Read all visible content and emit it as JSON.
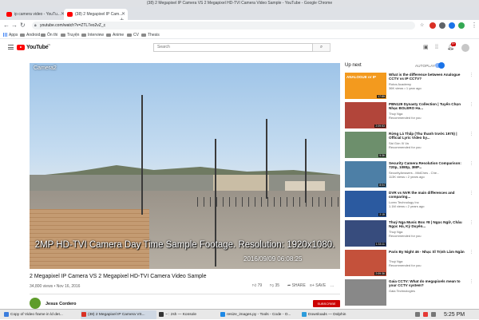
{
  "window": {
    "title": "(38) 2 Megapixel IP Camera VS 2 Megapixel HD-TVI Camera Video Sample - YouTube - Google Chrome"
  },
  "tabs": [
    {
      "label": "ip camera video - YouTu...",
      "active": false
    },
    {
      "label": "(38) 2 Megapixel IP Cam...",
      "active": true
    }
  ],
  "toolbar": {
    "back_icon": "arrow-left-icon",
    "forward_icon": "arrow-right-icon",
    "reload_icon": "reload-icon",
    "url": "youtube.com/watch?v=ZTL7eo2vZ_c",
    "star_icon": "star-icon",
    "menu_icon": "kebab-icon"
  },
  "bookmarks": [
    {
      "label": "Apps"
    },
    {
      "label": "Android"
    },
    {
      "label": "Ôn thi"
    },
    {
      "label": "Truyện"
    },
    {
      "label": "Interview"
    },
    {
      "label": "Anime"
    },
    {
      "label": "CV"
    },
    {
      "label": "Thesis"
    }
  ],
  "youtube": {
    "logo_text": "YouTube",
    "logo_country": "VN",
    "search_placeholder": "Search",
    "notification_count": "9+"
  },
  "video": {
    "camera_label": "Camera2",
    "caption": "2MP HD-TVI Camera Day Time Sample Footage. Resolution: 1920x1080.",
    "timestamp": "2016/09/09 06:08:25",
    "title": "2 Megapixel IP Camera VS 2 Megapixel HD-TVI Camera Video Sample",
    "views_date": "34,800 views • Nov 16, 2016",
    "likes": "79",
    "dislikes": "35",
    "share_label": "SHARE",
    "save_label": "SAVE",
    "more_label": "...",
    "channel": "Jesus Cordero",
    "subscribe_label": "SUBSCRIBE"
  },
  "sidebar": {
    "up_next_label": "Up next",
    "autoplay_label": "AUTOPLAY",
    "items": [
      {
        "title": "What is the difference between Analogue CCTV vs IP CCTV?",
        "channel": "Rotos Academy",
        "meta": "36K views • 1 year ago",
        "duration": "17:59",
        "thumb_color": "#f39a1e",
        "thumb_text": "ANALOGUE or IP"
      },
      {
        "title": "PBN129 Dynasty Collection | Tuyển Chọn Nhạc BOLERO Ha...",
        "channel": "Thuý Nga",
        "meta": "Recommended for you",
        "duration": "2:09:53",
        "thumb_color": "#b2453a",
        "thumb_text": ""
      },
      {
        "title": "Rừng Lá Thấp (Thu thanh trước 1975) | Official Lyric Video by...",
        "channel": "Sài Gòn Xi Va",
        "meta": "Recommended for you",
        "duration": "5:36",
        "thumb_color": "#6d8f6c",
        "thumb_text": ""
      },
      {
        "title": "Security Camera Resolution Comparison: 720p, 1080p, 3MP...",
        "channel": "SecurityAnswers - MidChes - Che...",
        "meta": "113K views • 2 years ago",
        "duration": "8:04",
        "thumb_color": "#4d7fa6",
        "thumb_text": ""
      },
      {
        "title": "DVR vs NVR the main differences and comparing...",
        "channel": "Lorex Technology Inc",
        "meta": "1.1M views • 2 years ago",
        "duration": "2:15",
        "thumb_color": "#2b5aa0",
        "thumb_text": ""
      },
      {
        "title": "Thuý Nga Music Box #8 | Ngọc Ngữ, Châu Ngọc Hà, Kỳ Duyên...",
        "channel": "Thuý Nga",
        "meta": "Recommended for you",
        "duration": "1:33:11",
        "thumb_color": "#374c7d",
        "thumb_text": ""
      },
      {
        "title": "Paris By Night 46 - Nhạc Sĩ Trịnh Lâm Ngân",
        "channel": "Thuý Nga",
        "meta": "Recommended for you",
        "duration": "2:09:36",
        "thumb_color": "#c4513b",
        "thumb_text": ""
      },
      {
        "title": "Gaia CCTV: What do megapixels mean to your CCTV system?",
        "channel": "Gaia Technologies",
        "meta": "",
        "duration": "",
        "thumb_color": "#888888",
        "thumb_text": ""
      }
    ]
  },
  "taskbar": {
    "tasks": [
      {
        "label": "Copy of Video frame in ld det...",
        "color": "#3b7ddd"
      },
      {
        "label": "(38) 2 Megapixel IP Camera VS...",
        "color": "#d93025"
      },
      {
        "label": "~ : zsh — Konsole",
        "color": "#333333"
      },
      {
        "label": "resize_images.py - Tools - Code - O...",
        "color": "#1e88e5"
      },
      {
        "label": "Downloads — Dolphin",
        "color": "#2d9cdb"
      }
    ],
    "clock": "5:25 PM"
  }
}
